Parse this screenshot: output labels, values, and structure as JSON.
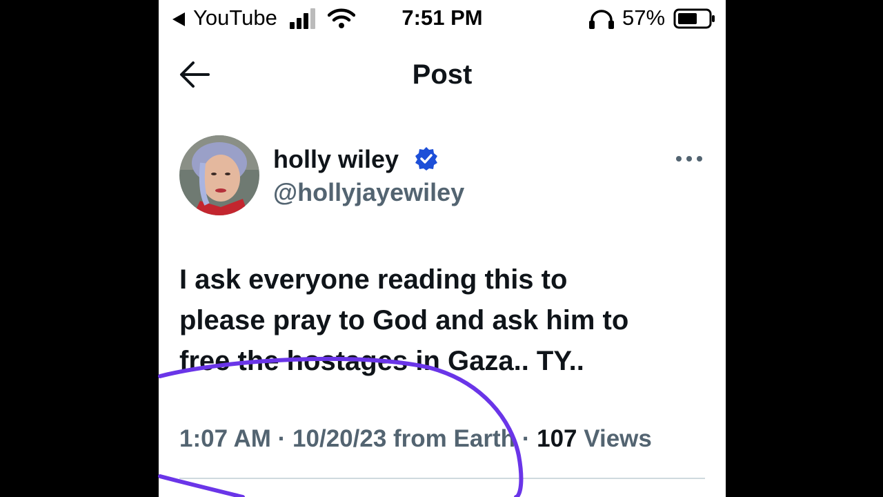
{
  "status_bar": {
    "back_app": "YouTube",
    "time": "7:51 PM",
    "battery_percent": "57%"
  },
  "nav": {
    "title": "Post"
  },
  "post": {
    "author_name": "holly wiley",
    "author_handle": "@hollyjayewiley",
    "text_lines": [
      "I ask everyone reading this to",
      "please pray to God and ask him to",
      "free the hostages in Gaza.. TY.."
    ],
    "meta": {
      "time": "1:07 AM",
      "date": "10/20/23",
      "source": "from Earth",
      "separator": "·",
      "views_count": "107",
      "views_label": "Views"
    }
  },
  "colors": {
    "verified": "#1d4fd8",
    "annotation": "#6a35e8",
    "secondary_text": "#536471"
  }
}
